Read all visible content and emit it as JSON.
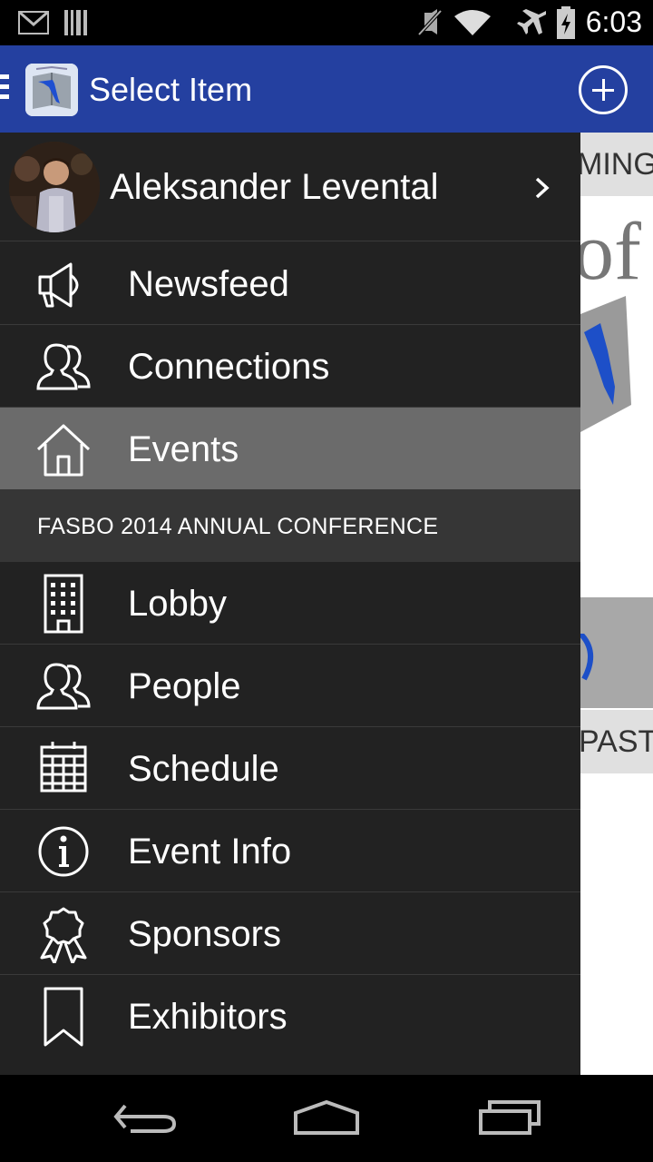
{
  "status_bar": {
    "time": "6:03",
    "icons": [
      "gmail-icon",
      "barcode-icon",
      "mute-icon",
      "wifi-icon",
      "airplane-mode-icon",
      "battery-icon"
    ]
  },
  "action_bar": {
    "title": "Select Item",
    "logo": "florida-book-logo",
    "action_icon": "add-circle-icon"
  },
  "drawer": {
    "profile": {
      "name": "Aleksander Levental",
      "icon": "chevron-right-icon"
    },
    "main_items": [
      {
        "label": "Newsfeed",
        "icon": "megaphone-icon",
        "selected": false
      },
      {
        "label": "Connections",
        "icon": "people-icon",
        "selected": false
      },
      {
        "label": "Events",
        "icon": "home-icon",
        "selected": true
      }
    ],
    "section_header": "FASBO 2014 ANNUAL CONFERENCE",
    "event_items": [
      {
        "label": "Lobby",
        "icon": "building-icon"
      },
      {
        "label": "People",
        "icon": "people-icon"
      },
      {
        "label": "Schedule",
        "icon": "calendar-icon"
      },
      {
        "label": "Event Info",
        "icon": "info-icon"
      },
      {
        "label": "Sponsors",
        "icon": "ribbon-icon"
      },
      {
        "label": "Exhibitors",
        "icon": "bookmark-icon"
      }
    ]
  },
  "background": {
    "upcoming_tab": "MING",
    "banner_text": "of",
    "past_tab": "PAST"
  },
  "nav_bar": {
    "icons": [
      "back-icon",
      "home-nav-icon",
      "recents-icon"
    ]
  },
  "colors": {
    "action_bar": "#2440a0",
    "drawer_bg": "#222222",
    "selected_item": "#6b6b6b",
    "section_header_bg": "#363636"
  }
}
